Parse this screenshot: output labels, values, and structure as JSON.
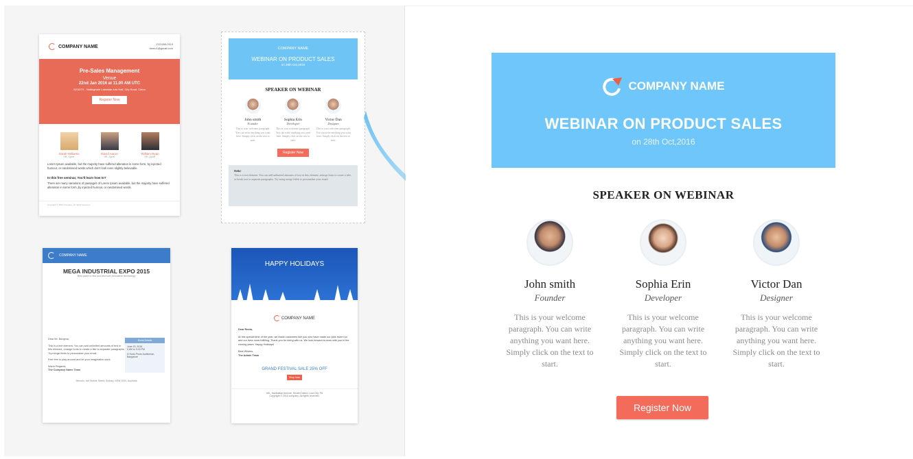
{
  "templates": {
    "t1": {
      "company": "COMPANY NAME",
      "phone": "222-659-0119",
      "email": "demo1@gmail.com",
      "title": "Pre-Sales Management",
      "venue": "Venue",
      "date": "22nd Jan 2016 at 11.00 AM UTC",
      "address": "B216/74 - Nottingham Lakeside Arts Hall, City Road, China",
      "button": "Register Now",
      "people": [
        {
          "name": "Sarah Williams",
          "role": "HR, Zyner"
        },
        {
          "name": "David Aaron",
          "role": "HR, Zyner"
        },
        {
          "name": "William Ryan",
          "role": "HR, Zyner"
        }
      ],
      "para1": "Lorem Ipsum available, but the majority have suffered alteration in some form, by injected humour, or randomised words which don't look even slightly believable.",
      "heading": "In this free seminar, You'll learn how to?",
      "para2": "There are many variations of passages of Lorem Ipsum available, but the majority have suffered alteration in some form, by injected humour, or randomised words.",
      "footer": "Copyright © 2016 company. All rights reserved."
    },
    "t2": {
      "company": "COMPANY NAME",
      "title": "WEBINAR ON PRODUCT SALES",
      "date": "on 28th Oct,2016",
      "heading": "SPEAKER ON WEBINAR",
      "people": [
        {
          "name": "John smith",
          "role": "Founder"
        },
        {
          "name": "Sophia Erin",
          "role": "Developer"
        },
        {
          "name": "Victor Dan",
          "role": "Designer"
        }
      ],
      "desc": "This is your welcome paragraph. You can write anything you want here. Simply click on the text to start.",
      "button": "Register Now",
      "hello": "Hello!",
      "text": "This is a text element. You can add unlimited amounts of text in this element, enlarge fonts to create a title, or break text to separate paragraphs. Try using merge fields to personalize your email."
    },
    "t3": {
      "company": "COMPANY NAME",
      "title": "MEGA INDUSTRIAL EXPO 2015",
      "subtitle": "Best place to find and discover innovative technology",
      "greeting": "Dear Mr. Bongma,",
      "body": "This is a text element. You can add unlimited amounts of text in this element, enlarge fonts to create a title to separate paragraphs. Try merge fields to personalize your email.",
      "body2": "Feel free to play around and let your imagination work.",
      "regards": "Warm Regards,",
      "team": "The Company Name Team",
      "event_head": "Event Details",
      "event_date": "June 15, 2015",
      "event_time": "9 AM to 5:30 PM",
      "event_place": "D Sudo Photo Auditorium, Bangalore",
      "footer": "Merculo, Net Mobile Street, Sydney, NSW 2000, Australia"
    },
    "t4": {
      "banner": "HAPPY HOLIDAYS",
      "company": "COMPANY NAME",
      "greeting": "Dear Reeta,",
      "body": "At this special time of the year, we thank customers like you who have made our jobs more fun and our lives more fulfilling. Thank you for being with us. We look forward to work with you in the coming years. Happy Holidays!",
      "wishes": "Best Wishes,",
      "team": "The Admin Team",
      "sale": "GRAND FESTIVAL SALE 25% OFF",
      "button": "Shop Now",
      "address": "#81, Manhattan Avenue, Shutter Island, Lost City, PA",
      "copyright": "Copyright © 2016 company. All rights reserved."
    }
  },
  "preview": {
    "company": "COMPANY NAME",
    "title": "WEBINAR ON PRODUCT SALES",
    "date": "on 28th Oct,2016",
    "heading": "SPEAKER ON WEBINAR",
    "people": [
      {
        "name": "John smith",
        "role": "Founder",
        "desc": "This is your welcome paragraph. You can write anything you want here. Simply click on the text to start."
      },
      {
        "name": "Sophia Erin",
        "role": "Developer",
        "desc": "This is your welcome paragraph. You can write anything you want here. Simply click on the text to start."
      },
      {
        "name": "Victor Dan",
        "role": "Designer",
        "desc": "This is your welcome paragraph. You can write anything you want here. Simply click on the text to start."
      }
    ],
    "button": "Register Now"
  },
  "colors": {
    "accent": "#f26b5b",
    "banner_blue": "#6ec6fa",
    "coral": "#e86b57",
    "corporate_blue": "#3d7cc9"
  }
}
